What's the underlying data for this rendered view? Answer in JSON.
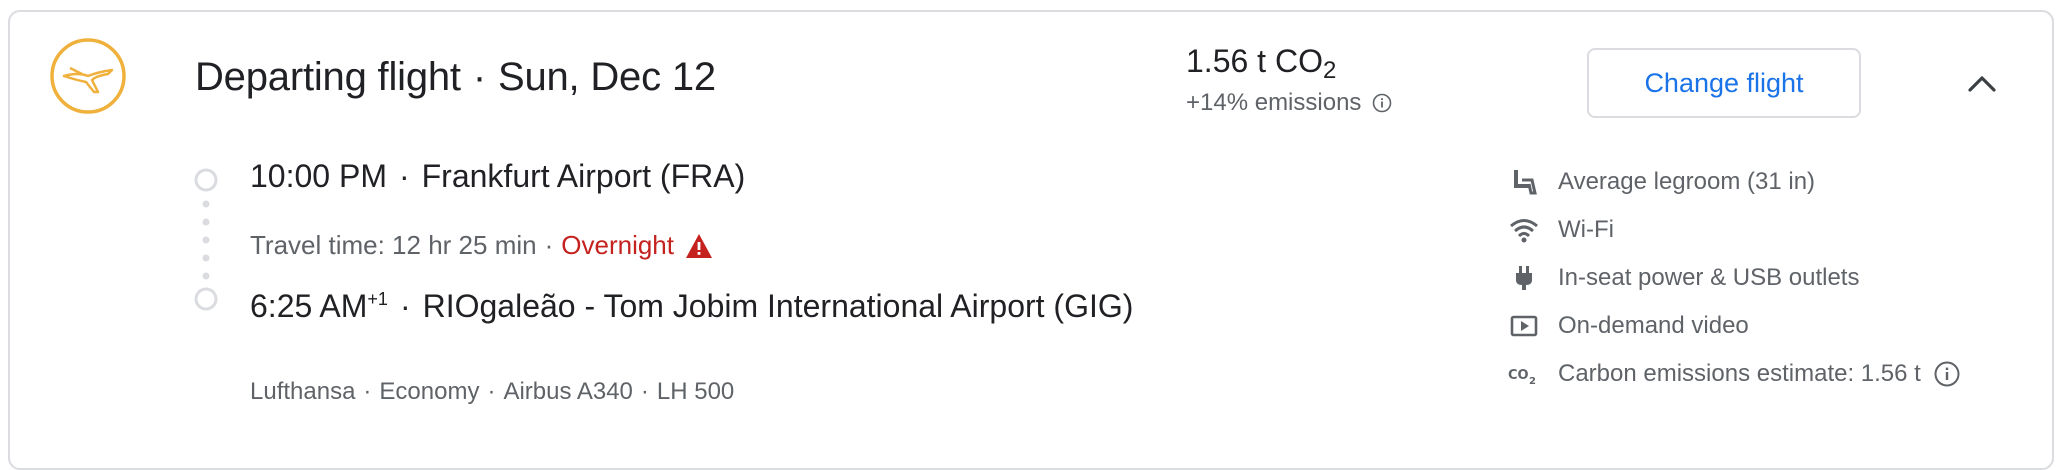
{
  "header": {
    "title": "Departing flight",
    "date": "Sun, Dec 12",
    "separator": "·"
  },
  "emissions": {
    "value": "1.56 t CO",
    "subscript": "2",
    "delta": "+14% emissions",
    "info_icon": "info-icon"
  },
  "actions": {
    "change_label": "Change flight",
    "collapse_icon": "chevron-up-icon"
  },
  "itinerary": {
    "departure_time": "10:00 PM",
    "departure_airport": "Frankfurt Airport (FRA)",
    "travel_time": "Travel time: 12 hr 25 min",
    "overnight": "Overnight",
    "arrival_time": "6:25 AM",
    "arrival_day_offset": "+1",
    "arrival_airport": "RIOgaleão - Tom Jobim International Airport (GIG)",
    "separator": "·"
  },
  "details": {
    "airline": "Lufthansa",
    "cabin": "Economy",
    "aircraft": "Airbus A340",
    "flight_number": "LH 500",
    "separator": "·"
  },
  "amenities": [
    {
      "icon": "legroom-seat-icon",
      "label": "Average legroom (31 in)"
    },
    {
      "icon": "wifi-icon",
      "label": "Wi-Fi"
    },
    {
      "icon": "power-plug-icon",
      "label": "In-seat power & USB outlets"
    },
    {
      "icon": "video-play-icon",
      "label": "On-demand video"
    },
    {
      "icon": "co2-icon",
      "label": "Carbon emissions estimate: 1.56 t"
    }
  ],
  "colors": {
    "accent_blue": "#1a73e8",
    "warning_red": "#c5221f",
    "logo_yellow": "#f0b13c",
    "muted_text": "#5f6368",
    "border": "#dadce0"
  }
}
